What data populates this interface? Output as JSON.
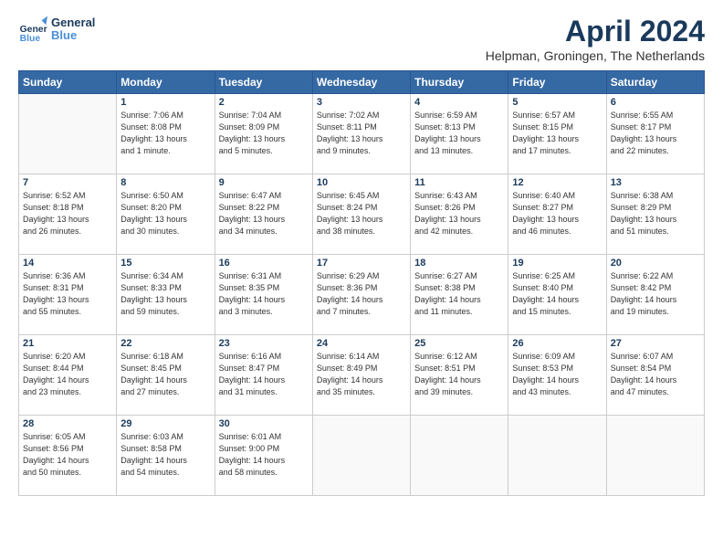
{
  "header": {
    "logo_line1": "General",
    "logo_line2": "Blue",
    "month_title": "April 2024",
    "location": "Helpman, Groningen, The Netherlands"
  },
  "weekdays": [
    "Sunday",
    "Monday",
    "Tuesday",
    "Wednesday",
    "Thursday",
    "Friday",
    "Saturday"
  ],
  "weeks": [
    [
      {
        "day": "",
        "content": ""
      },
      {
        "day": "1",
        "content": "Sunrise: 7:06 AM\nSunset: 8:08 PM\nDaylight: 13 hours\nand 1 minute."
      },
      {
        "day": "2",
        "content": "Sunrise: 7:04 AM\nSunset: 8:09 PM\nDaylight: 13 hours\nand 5 minutes."
      },
      {
        "day": "3",
        "content": "Sunrise: 7:02 AM\nSunset: 8:11 PM\nDaylight: 13 hours\nand 9 minutes."
      },
      {
        "day": "4",
        "content": "Sunrise: 6:59 AM\nSunset: 8:13 PM\nDaylight: 13 hours\nand 13 minutes."
      },
      {
        "day": "5",
        "content": "Sunrise: 6:57 AM\nSunset: 8:15 PM\nDaylight: 13 hours\nand 17 minutes."
      },
      {
        "day": "6",
        "content": "Sunrise: 6:55 AM\nSunset: 8:17 PM\nDaylight: 13 hours\nand 22 minutes."
      }
    ],
    [
      {
        "day": "7",
        "content": "Sunrise: 6:52 AM\nSunset: 8:18 PM\nDaylight: 13 hours\nand 26 minutes."
      },
      {
        "day": "8",
        "content": "Sunrise: 6:50 AM\nSunset: 8:20 PM\nDaylight: 13 hours\nand 30 minutes."
      },
      {
        "day": "9",
        "content": "Sunrise: 6:47 AM\nSunset: 8:22 PM\nDaylight: 13 hours\nand 34 minutes."
      },
      {
        "day": "10",
        "content": "Sunrise: 6:45 AM\nSunset: 8:24 PM\nDaylight: 13 hours\nand 38 minutes."
      },
      {
        "day": "11",
        "content": "Sunrise: 6:43 AM\nSunset: 8:26 PM\nDaylight: 13 hours\nand 42 minutes."
      },
      {
        "day": "12",
        "content": "Sunrise: 6:40 AM\nSunset: 8:27 PM\nDaylight: 13 hours\nand 46 minutes."
      },
      {
        "day": "13",
        "content": "Sunrise: 6:38 AM\nSunset: 8:29 PM\nDaylight: 13 hours\nand 51 minutes."
      }
    ],
    [
      {
        "day": "14",
        "content": "Sunrise: 6:36 AM\nSunset: 8:31 PM\nDaylight: 13 hours\nand 55 minutes."
      },
      {
        "day": "15",
        "content": "Sunrise: 6:34 AM\nSunset: 8:33 PM\nDaylight: 13 hours\nand 59 minutes."
      },
      {
        "day": "16",
        "content": "Sunrise: 6:31 AM\nSunset: 8:35 PM\nDaylight: 14 hours\nand 3 minutes."
      },
      {
        "day": "17",
        "content": "Sunrise: 6:29 AM\nSunset: 8:36 PM\nDaylight: 14 hours\nand 7 minutes."
      },
      {
        "day": "18",
        "content": "Sunrise: 6:27 AM\nSunset: 8:38 PM\nDaylight: 14 hours\nand 11 minutes."
      },
      {
        "day": "19",
        "content": "Sunrise: 6:25 AM\nSunset: 8:40 PM\nDaylight: 14 hours\nand 15 minutes."
      },
      {
        "day": "20",
        "content": "Sunrise: 6:22 AM\nSunset: 8:42 PM\nDaylight: 14 hours\nand 19 minutes."
      }
    ],
    [
      {
        "day": "21",
        "content": "Sunrise: 6:20 AM\nSunset: 8:44 PM\nDaylight: 14 hours\nand 23 minutes."
      },
      {
        "day": "22",
        "content": "Sunrise: 6:18 AM\nSunset: 8:45 PM\nDaylight: 14 hours\nand 27 minutes."
      },
      {
        "day": "23",
        "content": "Sunrise: 6:16 AM\nSunset: 8:47 PM\nDaylight: 14 hours\nand 31 minutes."
      },
      {
        "day": "24",
        "content": "Sunrise: 6:14 AM\nSunset: 8:49 PM\nDaylight: 14 hours\nand 35 minutes."
      },
      {
        "day": "25",
        "content": "Sunrise: 6:12 AM\nSunset: 8:51 PM\nDaylight: 14 hours\nand 39 minutes."
      },
      {
        "day": "26",
        "content": "Sunrise: 6:09 AM\nSunset: 8:53 PM\nDaylight: 14 hours\nand 43 minutes."
      },
      {
        "day": "27",
        "content": "Sunrise: 6:07 AM\nSunset: 8:54 PM\nDaylight: 14 hours\nand 47 minutes."
      }
    ],
    [
      {
        "day": "28",
        "content": "Sunrise: 6:05 AM\nSunset: 8:56 PM\nDaylight: 14 hours\nand 50 minutes."
      },
      {
        "day": "29",
        "content": "Sunrise: 6:03 AM\nSunset: 8:58 PM\nDaylight: 14 hours\nand 54 minutes."
      },
      {
        "day": "30",
        "content": "Sunrise: 6:01 AM\nSunset: 9:00 PM\nDaylight: 14 hours\nand 58 minutes."
      },
      {
        "day": "",
        "content": ""
      },
      {
        "day": "",
        "content": ""
      },
      {
        "day": "",
        "content": ""
      },
      {
        "day": "",
        "content": ""
      }
    ]
  ]
}
